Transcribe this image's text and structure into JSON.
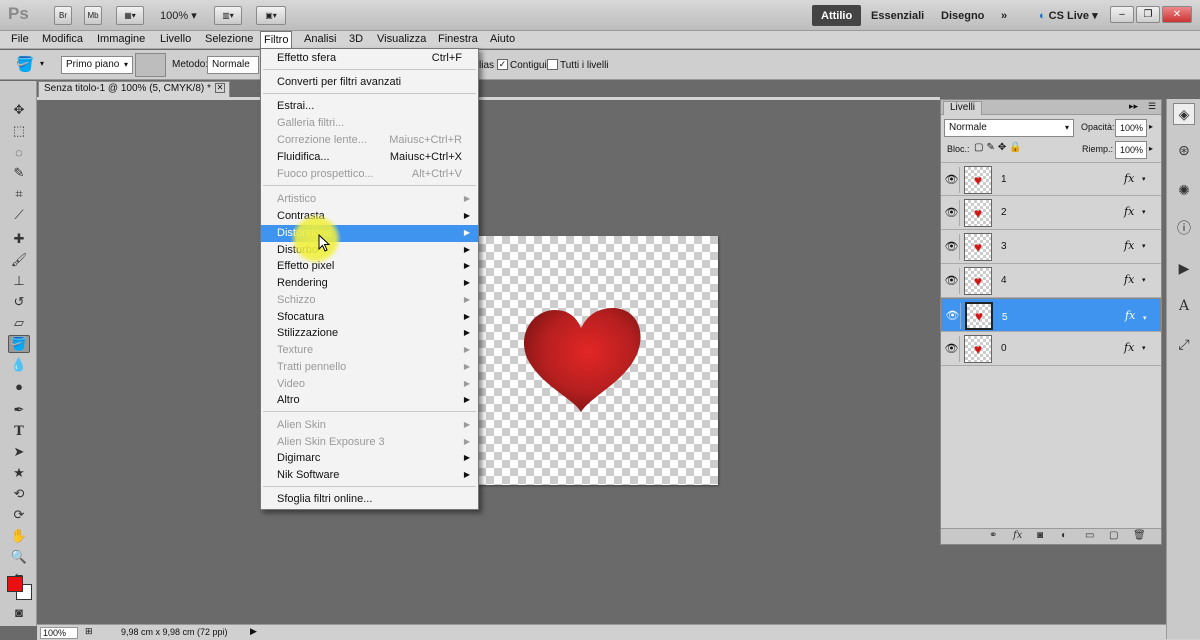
{
  "app": {
    "logo": "Ps",
    "bridge_label": "Br",
    "minibridge_label": "Mb",
    "zoom": "100%",
    "workspaces": [
      "Attilio",
      "Essenziali",
      "Disegno"
    ],
    "more_icon": "»",
    "cs_live": "CS Live"
  },
  "menubar": [
    "File",
    "Modifica",
    "Immagine",
    "Livello",
    "Selezione",
    "Filtro",
    "Analisi",
    "3D",
    "Visualizza",
    "Finestra",
    "Aiuto"
  ],
  "options": {
    "primo_piano": "Primo piano",
    "metodo_label": "Metodo:",
    "metodo_value": "Normale",
    "antialias_fragment": "lias",
    "contigui": "Contigui",
    "tutti_livelli": "Tutti i livelli"
  },
  "document": {
    "tab_title": "Senza titolo-1 @ 100% (5, CMYK/8) *",
    "status_zoom": "100%",
    "status_info": "9,98 cm x 9,98 cm (72 ppi)"
  },
  "filter_menu": {
    "items": [
      {
        "label": "Effetto sfera",
        "shortcut": "Ctrl+F",
        "enabled": true
      },
      {
        "label": "Converti per filtri avanzati",
        "enabled": true
      },
      {
        "label": "Estrai...",
        "enabled": true
      },
      {
        "label": "Galleria filtri...",
        "enabled": false
      },
      {
        "label": "Correzione lente...",
        "shortcut": "Maiusc+Ctrl+R",
        "enabled": false
      },
      {
        "label": "Fluidifica...",
        "shortcut": "Maiusc+Ctrl+X",
        "enabled": true
      },
      {
        "label": "Fuoco prospettico...",
        "shortcut": "Alt+Ctrl+V",
        "enabled": false
      },
      {
        "label": "Artistico",
        "submenu": true,
        "enabled": false
      },
      {
        "label": "Contrasta",
        "submenu": true,
        "enabled": true
      },
      {
        "label": "Distorsione",
        "submenu": true,
        "enabled": true,
        "highlighted": true
      },
      {
        "label": "Disturbo",
        "submenu": true,
        "enabled": true
      },
      {
        "label": "Effetto pixel",
        "submenu": true,
        "enabled": true
      },
      {
        "label": "Rendering",
        "submenu": true,
        "enabled": true
      },
      {
        "label": "Schizzo",
        "submenu": true,
        "enabled": false
      },
      {
        "label": "Sfocatura",
        "submenu": true,
        "enabled": true
      },
      {
        "label": "Stilizzazione",
        "submenu": true,
        "enabled": true
      },
      {
        "label": "Texture",
        "submenu": true,
        "enabled": false
      },
      {
        "label": "Tratti pennello",
        "submenu": true,
        "enabled": false
      },
      {
        "label": "Video",
        "submenu": true,
        "enabled": false
      },
      {
        "label": "Altro",
        "submenu": true,
        "enabled": true
      },
      {
        "label": "Alien Skin",
        "submenu": true,
        "enabled": false
      },
      {
        "label": "Alien Skin Exposure 3",
        "submenu": true,
        "enabled": false
      },
      {
        "label": "Digimarc",
        "submenu": true,
        "enabled": true
      },
      {
        "label": "Nik Software",
        "submenu": true,
        "enabled": true
      },
      {
        "label": "Sfoglia filtri online...",
        "enabled": true
      }
    ]
  },
  "layers_panel": {
    "title": "Livelli",
    "blend_mode": "Normale",
    "opacity_label": "Opacità:",
    "opacity_value": "100%",
    "lock_label": "Bloc.:",
    "fill_label": "Riemp.:",
    "fill_value": "100%",
    "layers": [
      {
        "name": "1",
        "fx": "fx",
        "selected": false
      },
      {
        "name": "2",
        "fx": "fx",
        "selected": false
      },
      {
        "name": "3",
        "fx": "fx",
        "selected": false
      },
      {
        "name": "4",
        "fx": "fx",
        "selected": false
      },
      {
        "name": "5",
        "fx": "fx",
        "selected": true
      },
      {
        "name": "0",
        "fx": "fx",
        "selected": false
      }
    ]
  },
  "colors": {
    "foreground": "#e81010",
    "background": "#ffffff",
    "highlight": "#3f94f0",
    "heart": "#a01c1c"
  }
}
